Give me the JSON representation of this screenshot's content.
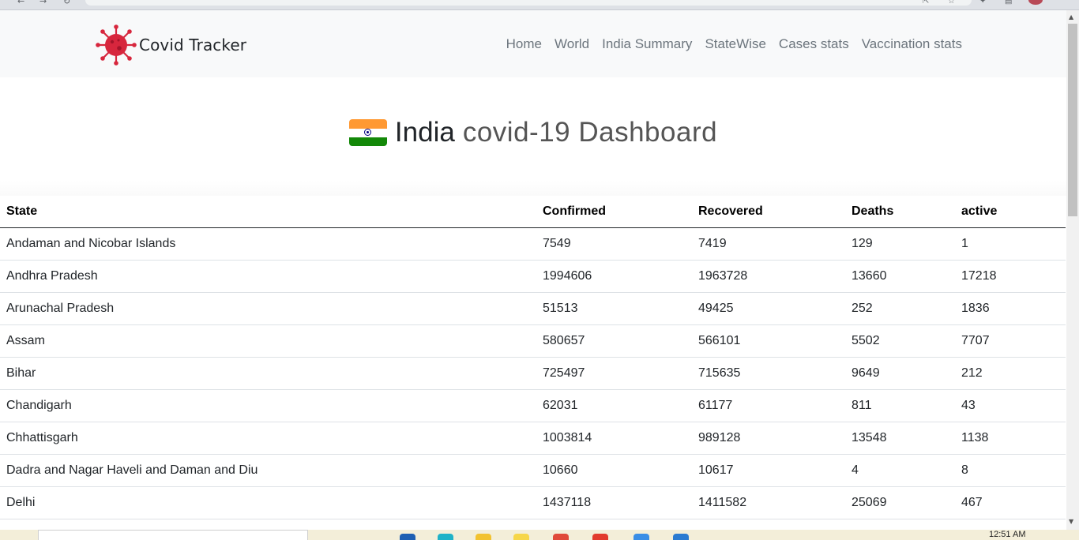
{
  "browser": {
    "url": "covid-tracker-india.netlify.app"
  },
  "navbar": {
    "brand": "Covid Tracker",
    "links": [
      "Home",
      "World",
      "India Summary",
      "StateWise",
      "Cases stats",
      "Vaccination stats"
    ]
  },
  "heading": {
    "strong": "India",
    "rest": "covid-19 Dashboard"
  },
  "table": {
    "headers": [
      "State",
      "Confirmed",
      "Recovered",
      "Deaths",
      "active"
    ],
    "rows": [
      [
        "Andaman and Nicobar Islands",
        "7549",
        "7419",
        "129",
        "1"
      ],
      [
        "Andhra Pradesh",
        "1994606",
        "1963728",
        "13660",
        "17218"
      ],
      [
        "Arunachal Pradesh",
        "51513",
        "49425",
        "252",
        "1836"
      ],
      [
        "Assam",
        "580657",
        "566101",
        "5502",
        "7707"
      ],
      [
        "Bihar",
        "725497",
        "715635",
        "9649",
        "212"
      ],
      [
        "Chandigarh",
        "62031",
        "61177",
        "811",
        "43"
      ],
      [
        "Chhattisgarh",
        "1003814",
        "989128",
        "13548",
        "1138"
      ],
      [
        "Dadra and Nagar Haveli and Daman and Diu",
        "10660",
        "10617",
        "4",
        "8"
      ],
      [
        "Delhi",
        "1437118",
        "1411582",
        "25069",
        "467"
      ]
    ]
  },
  "taskbar": {
    "clock": "12:51 AM"
  },
  "colors": {
    "virus_red": "#d7263d",
    "navbar_bg": "#f8f9fa",
    "nav_link": "#6c757d",
    "flag_saffron": "#ff9933",
    "flag_green": "#138808",
    "flag_chakra": "#000080"
  },
  "icons": {
    "brand": "virus-icon",
    "flag": "india-flag-icon"
  }
}
